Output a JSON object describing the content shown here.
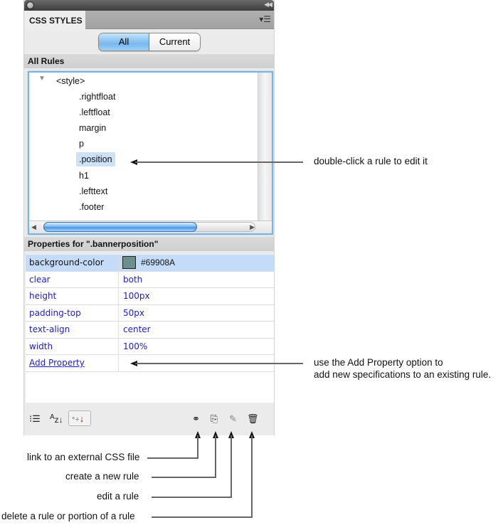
{
  "panel": {
    "tab_label": "CSS STYLES",
    "collapse_icon": "double-chevron-right",
    "menu_icon": "panel-menu"
  },
  "mode_switch": {
    "all_label": "All",
    "current_label": "Current",
    "selected": "All"
  },
  "rules_section": {
    "header": "All Rules",
    "root": "<style>",
    "rules": [
      ".rightfloat",
      ".leftfloat",
      "margin",
      "p",
      ".position",
      "h1",
      ".lefttext",
      ".footer"
    ],
    "selected_rule": ".position"
  },
  "properties_section": {
    "header": "Properties for \".bannerposition\"",
    "rows": [
      {
        "name": "background-color",
        "value": "#69908A",
        "swatch_color": "#69908A"
      },
      {
        "name": "clear",
        "value": "both"
      },
      {
        "name": "height",
        "value": "100px"
      },
      {
        "name": "padding-top",
        "value": "50px"
      },
      {
        "name": "text-align",
        "value": "center"
      },
      {
        "name": "width",
        "value": "100%"
      }
    ],
    "add_property_label": "Add Property"
  },
  "footer_toolbar": {
    "category_view_icon": "category-view-icon",
    "alpha_view_icon": "alphabetical-view-icon",
    "set_properties_icon": "show-set-properties-icon",
    "attach_icon": "link-icon",
    "new_rule_icon": "new-rule-icon",
    "edit_icon": "pencil-icon",
    "delete_icon": "trash-icon",
    "glyphs": {
      "category": "⁝☰",
      "alpha_a": "A",
      "alpha_z": "z",
      "down_arrow": "↓",
      "set_star": "*+",
      "link": "⚭",
      "new": "⎘",
      "edit": "✎",
      "delete": "🗑"
    }
  },
  "annotations": {
    "rule_edit": "double-click a rule to edit it",
    "add_property_line1": "use the Add Property option to",
    "add_property_line2": "add new specifications to an existing rule.",
    "link": "link to an external CSS file",
    "new_rule": "create a new rule",
    "edit_rule": "edit a rule",
    "delete_rule": "delete a rule or portion of a rule"
  },
  "colors": {
    "selection": "#cde1f8",
    "property_text": "#1e1eb4",
    "focus_border": "#7ab2e2"
  }
}
